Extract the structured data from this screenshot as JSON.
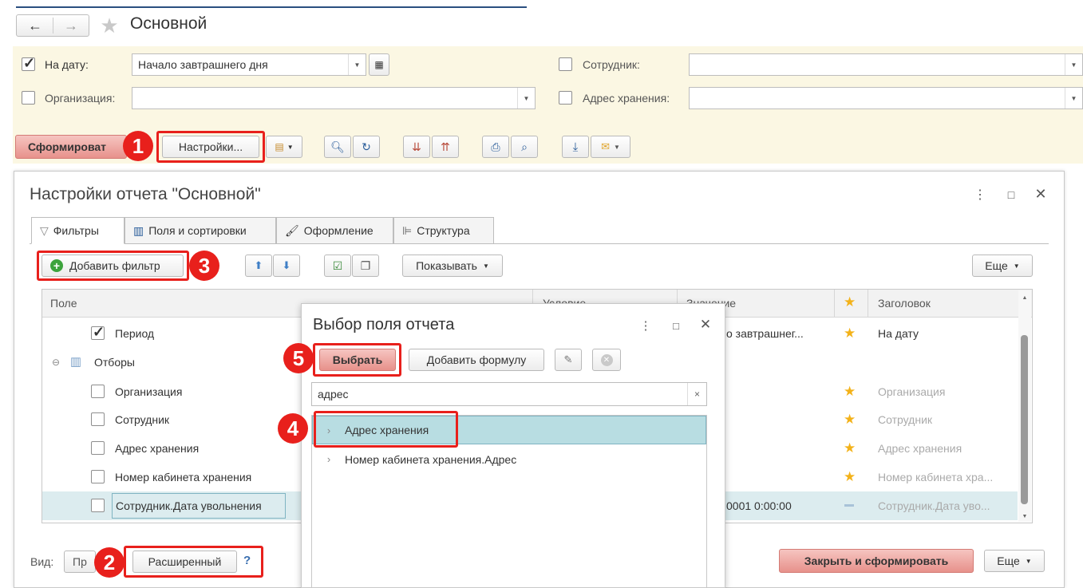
{
  "window": {
    "title": "Основной"
  },
  "filters": {
    "on_date_label": "На дату:",
    "on_date_value": "Начало завтрашнего дня",
    "organization_label": "Организация:",
    "employee_label": "Сотрудник:",
    "storage_address_label": "Адрес хранения:"
  },
  "toolbar": {
    "generate_label": "Сформироват",
    "settings_label": "Настройки..."
  },
  "settings_dialog": {
    "title": "Настройки отчета \"Основной\"",
    "tabs": [
      {
        "label": "Фильтры"
      },
      {
        "label": "Поля и сортировки"
      },
      {
        "label": "Оформление"
      },
      {
        "label": "Структура"
      }
    ],
    "add_filter_label": "Добавить фильтр",
    "show_label": "Показывать",
    "more_label": "Еще",
    "columns": {
      "field": "Поле",
      "condition": "Условие",
      "value": "Значение",
      "heading": "Заголовок"
    },
    "rows": [
      {
        "label": "Период",
        "value": "о завтрашнег...",
        "heading": "На дату"
      },
      {
        "label": "Отборы"
      },
      {
        "label": "Организация",
        "heading": "Организация"
      },
      {
        "label": "Сотрудник",
        "heading": "Сотрудник"
      },
      {
        "label": "Адрес хранения",
        "heading": "Адрес хранения"
      },
      {
        "label": "Номер кабинета хранения",
        "heading": "Номер кабинета хра..."
      },
      {
        "label": "Сотрудник.Дата увольнения",
        "value": "0001 0:00:00",
        "heading": "Сотрудник.Дата уво..."
      }
    ],
    "view_label": "Вид:",
    "view_simple_label": "Пр",
    "view_advanced_label": "Расширенный",
    "help_label": "?",
    "close_generate_label": "Закрыть и сформировать",
    "more_bottom_label": "Еще"
  },
  "field_dialog": {
    "title": "Выбор поля отчета",
    "select_label": "Выбрать",
    "add_formula_label": "Добавить формулу",
    "search_value": "адрес",
    "items": [
      {
        "label": "Адрес хранения"
      },
      {
        "label": "Номер кабинета хранения.Адрес"
      }
    ]
  },
  "annotations": [
    "1",
    "2",
    "3",
    "4",
    "5"
  ],
  "colors": {
    "accent_red": "#e8201c",
    "filter_bg": "#fbf7e3",
    "selected_row": "#dcecef",
    "highlight_item": "#b8dde2",
    "star": "#f3b21a"
  }
}
